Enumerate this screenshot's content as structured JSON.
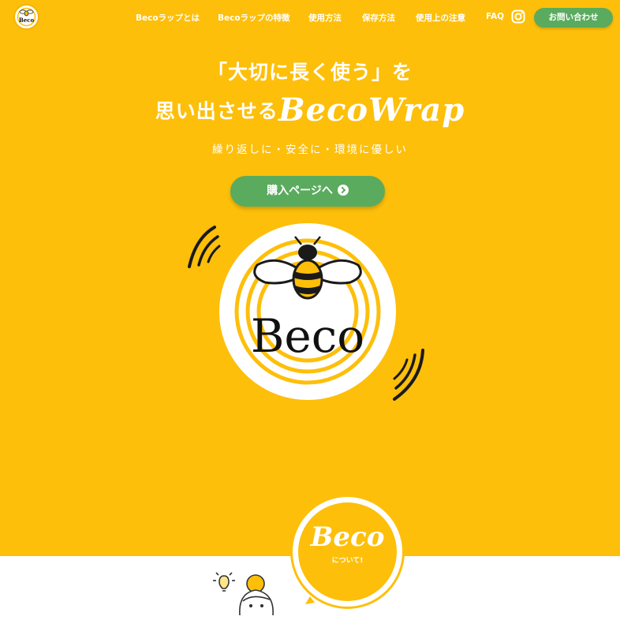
{
  "header": {
    "logo_text": "Beco",
    "nav": [
      {
        "label": "Becoラップとは"
      },
      {
        "label": "Becoラップの特徴"
      },
      {
        "label": "使用方法"
      },
      {
        "label": "保存方法"
      },
      {
        "label": "使用上の注意"
      },
      {
        "label": "FAQ"
      }
    ],
    "instagram_icon": "instagram-icon",
    "contact_label": "お問い合わせ"
  },
  "hero": {
    "line1": "「大切に長く使う」を",
    "line2_prefix": "思い出させる",
    "line2_brand": "BecoWrap",
    "subtitle": "繰り返しに・安全に・環境に優しい",
    "buy_label": "購入ページへ",
    "logo_text": "Beco"
  },
  "about": {
    "title": "Beco",
    "subtitle": "について!"
  },
  "colors": {
    "background": "#fdbf0a",
    "button_green": "#5aab5e",
    "white": "#ffffff",
    "ink": "#1a1a1a"
  }
}
